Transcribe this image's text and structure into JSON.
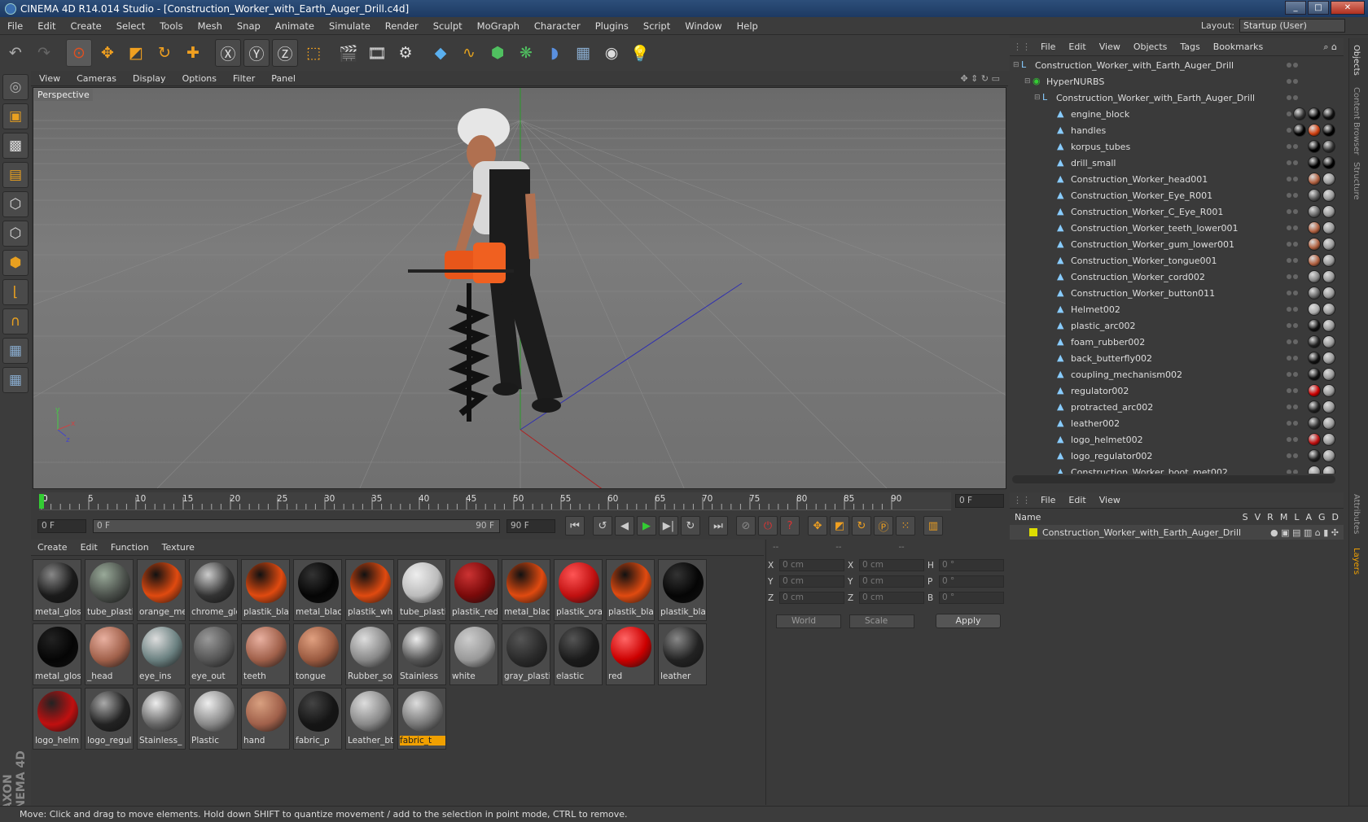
{
  "window": {
    "title": "CINEMA 4D R14.014 Studio - [Construction_Worker_with_Earth_Auger_Drill.c4d]",
    "min": "_",
    "max": "□",
    "close": "✕"
  },
  "menubar": {
    "items": [
      "File",
      "Edit",
      "Create",
      "Select",
      "Tools",
      "Mesh",
      "Snap",
      "Animate",
      "Simulate",
      "Render",
      "Sculpt",
      "MoGraph",
      "Character",
      "Plugins",
      "Script",
      "Window",
      "Help"
    ],
    "layout_label": "Layout:",
    "layout_value": "Startup (User)"
  },
  "viewport": {
    "menu": [
      "View",
      "Cameras",
      "Display",
      "Options",
      "Filter",
      "Panel"
    ],
    "label": "Perspective"
  },
  "timeline": {
    "ticks": [
      "0",
      "5",
      "10",
      "15",
      "20",
      "25",
      "30",
      "35",
      "40",
      "45",
      "50",
      "55",
      "60",
      "65",
      "70",
      "75",
      "80",
      "85",
      "90"
    ],
    "current_frame": "0 F"
  },
  "transport": {
    "start": "0 F",
    "range_start": "0 F",
    "range_end": "90 F",
    "end": "90 F"
  },
  "materials": {
    "menu": [
      "Create",
      "Edit",
      "Function",
      "Texture"
    ],
    "items": [
      {
        "name": "metal_glos",
        "color": "#1a1a1a",
        "hi": "#888"
      },
      {
        "name": "tube_plasti",
        "color": "#4a4f4a",
        "hi": "#9a9"
      },
      {
        "name": "orange_me",
        "color": "#e04a10",
        "hi": "#111"
      },
      {
        "name": "chrome_glo",
        "color": "#333",
        "hi": "#ccc"
      },
      {
        "name": "plastik_bla",
        "color": "#e04a10",
        "hi": "#111"
      },
      {
        "name": "metal_black",
        "color": "#050505",
        "hi": "#333"
      },
      {
        "name": "plastik_wh",
        "color": "#e04a10",
        "hi": "#111"
      },
      {
        "name": "tube_plasti",
        "color": "#bbb",
        "hi": "#eee"
      },
      {
        "name": "plastik_red",
        "color": "#7a0a0a",
        "hi": "#c33"
      },
      {
        "name": "metal_black",
        "color": "#e04a10",
        "hi": "#111"
      },
      {
        "name": "plastik_ora",
        "color": "#c01010",
        "hi": "#f55"
      },
      {
        "name": "plastik_bla",
        "color": "#e04a10",
        "hi": "#111"
      },
      {
        "name": "plastik_bla",
        "color": "#050505",
        "hi": "#333"
      },
      {
        "name": "metal_glos",
        "color": "#050505",
        "hi": "#222"
      },
      {
        "name": "_head",
        "color": "#a0604a",
        "hi": "#e8b0a0"
      },
      {
        "name": "eye_ins",
        "color": "#6a8080",
        "hi": "#ddd"
      },
      {
        "name": "eye_out",
        "color": "#555",
        "hi": "#999"
      },
      {
        "name": "teeth",
        "color": "#a0604a",
        "hi": "#e8b0a0"
      },
      {
        "name": "tongue",
        "color": "#9a5a40",
        "hi": "#e0a080"
      },
      {
        "name": "Rubber_so",
        "color": "#888",
        "hi": "#ddd"
      },
      {
        "name": "Stainless",
        "color": "#555",
        "hi": "#eee"
      },
      {
        "name": "white",
        "color": "#999",
        "hi": "#ccc"
      },
      {
        "name": "gray_plasti",
        "color": "#2a2a2a",
        "hi": "#555"
      },
      {
        "name": "elastic",
        "color": "#1a1a1a",
        "hi": "#555"
      },
      {
        "name": "red",
        "color": "#c00",
        "hi": "#f66"
      },
      {
        "name": "leather",
        "color": "#222",
        "hi": "#888"
      },
      {
        "name": "logo_helm",
        "color": "#c01010",
        "hi": "#222"
      },
      {
        "name": "logo_regul",
        "color": "#222",
        "hi": "#aaa"
      },
      {
        "name": "Stainless_",
        "color": "#666",
        "hi": "#eee"
      },
      {
        "name": "Plastic",
        "color": "#888",
        "hi": "#eee"
      },
      {
        "name": "hand",
        "color": "#a0604a",
        "hi": "#d8a080"
      },
      {
        "name": "fabric_p",
        "color": "#151515",
        "hi": "#444"
      },
      {
        "name": "Leather_bt",
        "color": "#888",
        "hi": "#ddd"
      },
      {
        "name": "fabric_t",
        "color": "#777",
        "hi": "#ddd"
      }
    ]
  },
  "coordinates": {
    "header": [
      "--",
      "--",
      "--"
    ],
    "rows": [
      {
        "a": "X",
        "av": "0 cm",
        "b": "X",
        "bv": "0 cm",
        "c": "H",
        "cv": "0 °"
      },
      {
        "a": "Y",
        "av": "0 cm",
        "b": "Y",
        "bv": "0 cm",
        "c": "P",
        "cv": "0 °"
      },
      {
        "a": "Z",
        "av": "0 cm",
        "b": "Z",
        "bv": "0 cm",
        "c": "B",
        "cv": "0 °"
      }
    ],
    "mode": "World",
    "scale": "Scale",
    "apply": "Apply"
  },
  "objects": {
    "menu": [
      "File",
      "Edit",
      "View",
      "Objects",
      "Tags",
      "Bookmarks"
    ],
    "rows": [
      {
        "name": "Construction_Worker_with_Earth_Auger_Drill",
        "tags": []
      },
      {
        "name": "HyperNURBS",
        "tags": []
      },
      {
        "name": "Construction_Worker_with_Earth_Auger_Drill",
        "tags": []
      },
      {
        "name": "engine_block",
        "tags": [
          "#333",
          "#000",
          "#111"
        ]
      },
      {
        "name": "handles",
        "tags": [
          "#000",
          "#d04010",
          "#000"
        ]
      },
      {
        "name": "korpus_tubes",
        "tags": [
          "#000",
          "#333"
        ]
      },
      {
        "name": "drill_small",
        "tags": [
          "#000",
          "#000"
        ]
      },
      {
        "name": "Construction_Worker_head001",
        "tags": [
          "#b06040",
          "#999"
        ]
      },
      {
        "name": "Construction_Worker_Eye_R001",
        "tags": [
          "#555",
          "#999"
        ]
      },
      {
        "name": "Construction_Worker_C_Eye_R001",
        "tags": [
          "#666",
          "#999"
        ]
      },
      {
        "name": "Construction_Worker_teeth_lower001",
        "tags": [
          "#b06040",
          "#999"
        ]
      },
      {
        "name": "Construction_Worker_gum_lower001",
        "tags": [
          "#b06040",
          "#999"
        ]
      },
      {
        "name": "Construction_Worker_tongue001",
        "tags": [
          "#b06040",
          "#999"
        ]
      },
      {
        "name": "Construction_Worker_cord002",
        "tags": [
          "#888",
          "#999"
        ]
      },
      {
        "name": "Construction_Worker_button011",
        "tags": [
          "#666",
          "#999"
        ]
      },
      {
        "name": "Helmet002",
        "tags": [
          "#aaa",
          "#999"
        ]
      },
      {
        "name": "plastic_arc002",
        "tags": [
          "#111",
          "#999"
        ]
      },
      {
        "name": "foam_rubber002",
        "tags": [
          "#222",
          "#999"
        ]
      },
      {
        "name": "back_butterfly002",
        "tags": [
          "#111",
          "#999"
        ]
      },
      {
        "name": "coupling_mechanism002",
        "tags": [
          "#111",
          "#999"
        ]
      },
      {
        "name": "regulator002",
        "tags": [
          "#c00",
          "#999"
        ]
      },
      {
        "name": "protracted_arc002",
        "tags": [
          "#222",
          "#999"
        ]
      },
      {
        "name": "leather002",
        "tags": [
          "#333",
          "#999"
        ]
      },
      {
        "name": "logo_helmet002",
        "tags": [
          "#c01010",
          "#999"
        ]
      },
      {
        "name": "logo_regulator002",
        "tags": [
          "#222",
          "#999"
        ]
      },
      {
        "name": "Construction_Worker_boot_met002",
        "tags": [
          "#999",
          "#999"
        ]
      }
    ]
  },
  "layers": {
    "menu": [
      "File",
      "Edit",
      "View"
    ],
    "head_name": "Name",
    "head_cols": [
      "S",
      "V",
      "R",
      "M",
      "L",
      "A",
      "G",
      "D"
    ],
    "row": "Construction_Worker_with_Earth_Auger_Drill"
  },
  "right_tabs": [
    "Objects",
    "Content Browser",
    "Structure",
    "Attributes",
    "Layers"
  ],
  "status": "Move: Click and drag to move elements. Hold down SHIFT to quantize movement / add to the selection in point mode, CTRL to remove.",
  "colors": {
    "accent": "#f0a000",
    "select_label": "#f0a000"
  }
}
